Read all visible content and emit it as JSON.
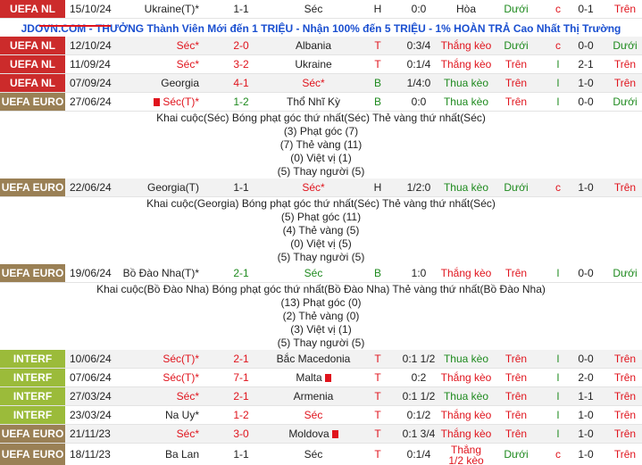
{
  "banner": {
    "text": "JDOVN.COM - THƯỞNG Thành Viên Mới đến 1 TRIỆU - Nhận 100% đến 5 TRIỆU - 1% HOÀN TRẢ Cao Nhất Thị Trường"
  },
  "colors": {
    "uefa_nl": "#cc2b2b",
    "uefa_euro": "#9a8055",
    "interf": "#9bbb3a",
    "red": "#e0141d",
    "green": "#1e8a1e",
    "banner_blue": "#1a4fd0"
  },
  "matches": [
    {
      "comp": "UEFA NL",
      "date": "15/10/24",
      "home": "Ukraine(T)*",
      "score": "1-1",
      "away": "Séc",
      "ha": "H",
      "ah": "0:0",
      "res": "Hòa",
      "ou": "Dưới",
      "c": "c",
      "ht": "0-1",
      "ou2": "Trên"
    },
    {
      "comp": "UEFA NL",
      "date": "12/10/24",
      "home": "Séc*",
      "score": "2-0",
      "away": "Albania",
      "ha": "T",
      "ah": "0:3/4",
      "res": "Thắng kèo",
      "ou": "Dưới",
      "c": "c",
      "ht": "0-0",
      "ou2": "Dưới"
    },
    {
      "comp": "UEFA NL",
      "date": "11/09/24",
      "home": "Séc*",
      "score": "3-2",
      "away": "Ukraine",
      "ha": "T",
      "ah": "0:1/4",
      "res": "Thắng kèo",
      "ou": "Trên",
      "c": "l",
      "ht": "2-1",
      "ou2": "Trên"
    },
    {
      "comp": "UEFA NL",
      "date": "07/09/24",
      "home": "Georgia",
      "score": "4-1",
      "away": "Séc*",
      "ha": "B",
      "ah": "1/4:0",
      "res": "Thua kèo",
      "ou": "Trên",
      "c": "l",
      "ht": "1-0",
      "ou2": "Trên"
    },
    {
      "comp": "UEFA EURO",
      "date": "27/06/24",
      "home": "Séc(T)*",
      "score": "1-2",
      "away": "Thổ Nhĩ Kỳ",
      "ha": "B",
      "ah": "0:0",
      "res": "Thua kèo",
      "ou": "Trên",
      "c": "l",
      "ht": "0-0",
      "ou2": "Dưới",
      "stats": [
        "Khai cuộc(Séc)  Bóng phạt góc thứ nhất(Séc)  Thẻ vàng thứ nhất(Séc)",
        "(3) Phạt góc (7)",
        "(7) Thẻ vàng (11)",
        "(0) Việt vị (1)",
        "(5) Thay người (5)"
      ]
    },
    {
      "comp": "UEFA EURO",
      "date": "22/06/24",
      "home": "Georgia(T)",
      "score": "1-1",
      "away": "Séc*",
      "ha": "H",
      "ah": "1/2:0",
      "res": "Thua kèo",
      "ou": "Dưới",
      "c": "c",
      "ht": "1-0",
      "ou2": "Trên",
      "stats": [
        "Khai cuộc(Georgia)  Bóng phạt góc thứ nhất(Séc)  Thẻ vàng thứ nhất(Séc)",
        "(5) Phạt góc (11)",
        "(4) Thẻ vàng (5)",
        "(0) Việt vị (5)",
        "(5) Thay người (5)"
      ]
    },
    {
      "comp": "UEFA EURO",
      "date": "19/06/24",
      "home": "Bồ Đào Nha(T)*",
      "score": "2-1",
      "away": "Séc",
      "ha": "B",
      "ah": "1:0",
      "res": "Thắng kèo",
      "ou": "Trên",
      "c": "l",
      "ht": "0-0",
      "ou2": "Dưới",
      "stats": [
        "Khai cuộc(Bồ Đào Nha)  Bóng phạt góc thứ nhất(Bồ Đào Nha)  Thẻ vàng thứ nhất(Bồ Đào Nha)",
        "(13) Phạt góc (0)",
        "(2) Thẻ vàng (0)",
        "(3) Việt vị (1)",
        "(5) Thay người (5)"
      ]
    },
    {
      "comp": "INTERF",
      "date": "10/06/24",
      "home": "Séc(T)*",
      "score": "2-1",
      "away": "Bắc Macedonia",
      "ha": "T",
      "ah": "0:1 1/2",
      "res": "Thua kèo",
      "ou": "Trên",
      "c": "l",
      "ht": "0-0",
      "ou2": "Trên"
    },
    {
      "comp": "INTERF",
      "date": "07/06/24",
      "home": "Séc(T)*",
      "score": "7-1",
      "away": "Malta",
      "ha": "T",
      "ah": "0:2",
      "res": "Thắng kèo",
      "ou": "Trên",
      "c": "l",
      "ht": "2-0",
      "ou2": "Trên"
    },
    {
      "comp": "INTERF",
      "date": "27/03/24",
      "home": "Séc*",
      "score": "2-1",
      "away": "Armenia",
      "ha": "T",
      "ah": "0:1 1/2",
      "res": "Thua kèo",
      "ou": "Trên",
      "c": "l",
      "ht": "1-1",
      "ou2": "Trên"
    },
    {
      "comp": "INTERF",
      "date": "23/03/24",
      "home": "Na Uy*",
      "score": "1-2",
      "away": "Séc",
      "ha": "T",
      "ah": "0:1/2",
      "res": "Thắng kèo",
      "ou": "Trên",
      "c": "l",
      "ht": "1-0",
      "ou2": "Trên"
    },
    {
      "comp": "UEFA EURO",
      "date": "21/11/23",
      "home": "Séc*",
      "score": "3-0",
      "away": "Moldova",
      "ha": "T",
      "ah": "0:1 3/4",
      "res": "Thắng kèo",
      "ou": "Trên",
      "c": "l",
      "ht": "1-0",
      "ou2": "Trên"
    },
    {
      "comp": "UEFA EURO",
      "date": "18/11/23",
      "home": "Ba Lan",
      "score": "1-1",
      "away": "Séc",
      "ha": "T",
      "ah": "0:1/4",
      "res": "Thắng 1/2 kèo",
      "ou": "Dưới",
      "c": "c",
      "ht": "1-0",
      "ou2": "Trên"
    }
  ]
}
